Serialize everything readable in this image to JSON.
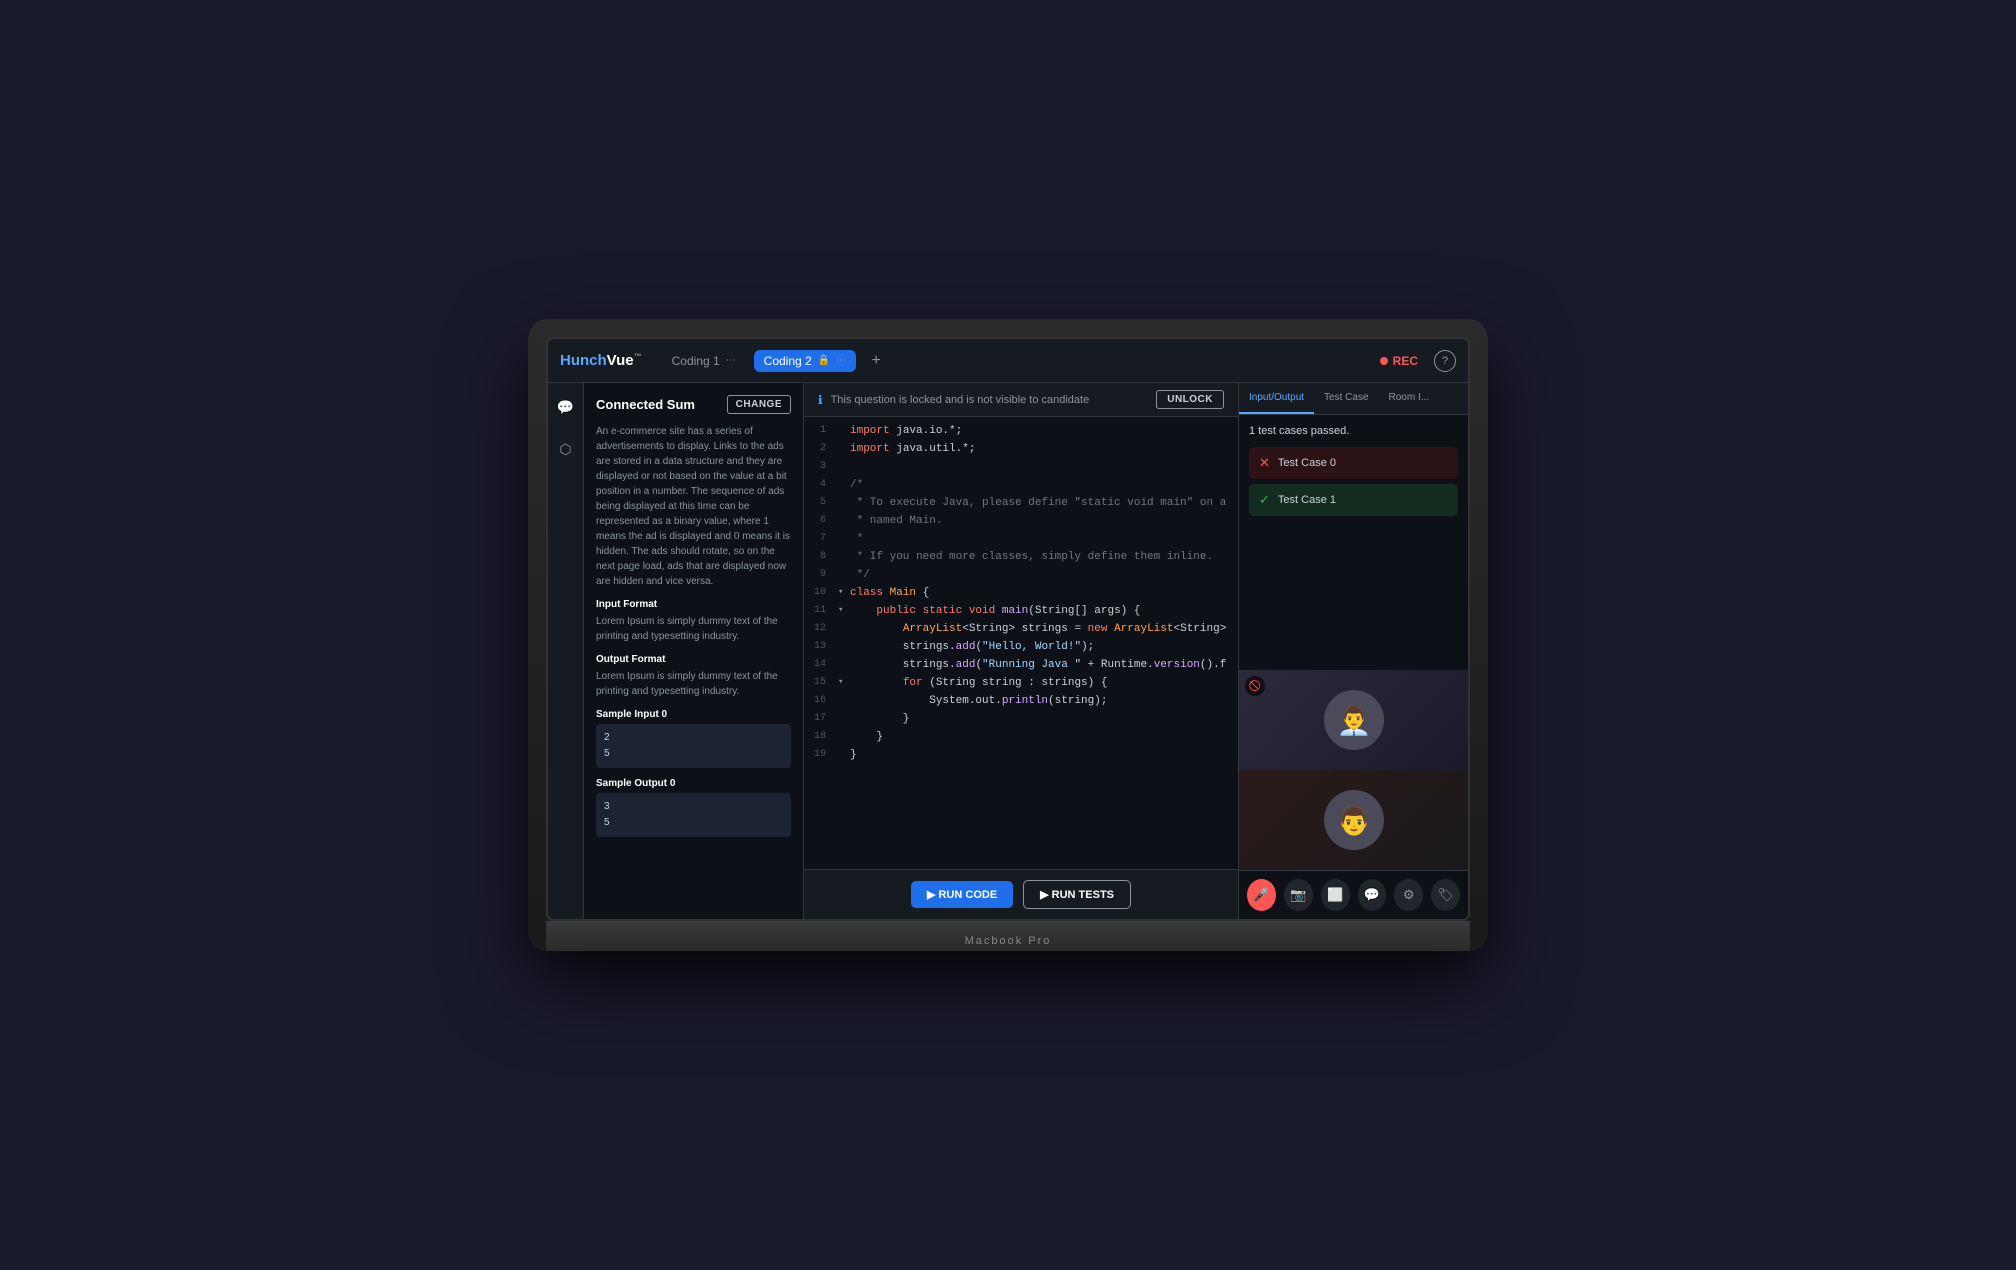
{
  "app": {
    "logo_text": "HunchVue",
    "logo_tm": "™"
  },
  "topbar": {
    "tabs": [
      {
        "label": "Coding 1",
        "active": false,
        "locked": false
      },
      {
        "label": "Coding 2",
        "active": true,
        "locked": true
      }
    ],
    "add_tab_label": "+",
    "rec_label": "REC",
    "help_label": "?"
  },
  "lock_banner": {
    "info_text": "This question is locked and is not visible to candidate",
    "unlock_label": "UNLOCK"
  },
  "problem": {
    "title": "Connected Sum",
    "change_label": "CHANGE",
    "description": "An e-commerce site has a series of advertisements to display. Links to the ads are stored in a data structure and they are displayed or not based on the value at a bit position in a number. The sequence of ads being displayed at this time can be represented as a binary value, where 1 means the ad is displayed and 0 means it is hidden. The ads should rotate, so on the next page load, ads that are displayed now are hidden and vice versa.",
    "input_format_title": "Input Format",
    "input_format_text": "Lorem Ipsum is simply dummy text of the printing and typesetting industry.",
    "output_format_title": "Output Format",
    "output_format_text": "Lorem Ipsum is simply dummy text of the printing and typesetting industry.",
    "sample_input_title": "Sample Input 0",
    "sample_input_values": [
      "2",
      "5"
    ],
    "sample_output_title": "Sample Output 0",
    "sample_output_values": [
      "3",
      "5"
    ]
  },
  "code": {
    "lines": [
      {
        "num": 1,
        "content": "import java.io.*;",
        "arrow": ""
      },
      {
        "num": 2,
        "content": "import java.util.*;",
        "arrow": ""
      },
      {
        "num": 3,
        "content": "",
        "arrow": ""
      },
      {
        "num": 4,
        "content": "/*",
        "arrow": ""
      },
      {
        "num": 5,
        "content": " * To execute Java, please define \"static void main\" on a",
        "arrow": ""
      },
      {
        "num": 6,
        "content": " * named Main.",
        "arrow": ""
      },
      {
        "num": 7,
        "content": " *",
        "arrow": ""
      },
      {
        "num": 8,
        "content": " * If you need more classes, simply define them inline.",
        "arrow": ""
      },
      {
        "num": 9,
        "content": " */",
        "arrow": ""
      },
      {
        "num": 10,
        "content": "class Main {",
        "arrow": "▾"
      },
      {
        "num": 11,
        "content": "    public static void main(String[] args) {",
        "arrow": "▾"
      },
      {
        "num": 12,
        "content": "        ArrayList<String> strings = new ArrayList<String>",
        "arrow": ""
      },
      {
        "num": 13,
        "content": "        strings.add(\"Hello, World!\");",
        "arrow": ""
      },
      {
        "num": 14,
        "content": "        strings.add(\"Running Java \" + Runtime.version().f",
        "arrow": ""
      },
      {
        "num": 15,
        "content": "        for (String string : strings) {",
        "arrow": "▾"
      },
      {
        "num": 16,
        "content": "            System.out.println(string);",
        "arrow": ""
      },
      {
        "num": 17,
        "content": "        }",
        "arrow": ""
      },
      {
        "num": 18,
        "content": "    }",
        "arrow": ""
      },
      {
        "num": 19,
        "content": "}",
        "arrow": ""
      }
    ]
  },
  "editor_bottom": {
    "run_code_label": "▶ RUN CODE",
    "run_tests_label": "▶ RUN TESTS"
  },
  "right_panel": {
    "tabs": [
      {
        "label": "Input/Output",
        "active": true
      },
      {
        "label": "Test Case",
        "active": false
      },
      {
        "label": "Room I...",
        "active": false
      }
    ],
    "test_summary": "1 test cases passed.",
    "test_cases": [
      {
        "label": "Test Case 0",
        "status": "fail"
      },
      {
        "label": "Test Case 1",
        "status": "pass"
      }
    ]
  },
  "bottom_toolbar": {
    "buttons": [
      {
        "icon": "🎤",
        "label": "mic-button",
        "muted": true
      },
      {
        "icon": "📹",
        "label": "video-button",
        "muted": false
      },
      {
        "icon": "⬜",
        "label": "screen-button",
        "muted": false
      },
      {
        "icon": "💬",
        "label": "chat-button",
        "muted": false
      },
      {
        "icon": "⚙",
        "label": "settings-button",
        "muted": false
      },
      {
        "icon": "🏷",
        "label": "tag-button",
        "muted": false
      }
    ]
  },
  "macbook_label": "Macbook Pro"
}
